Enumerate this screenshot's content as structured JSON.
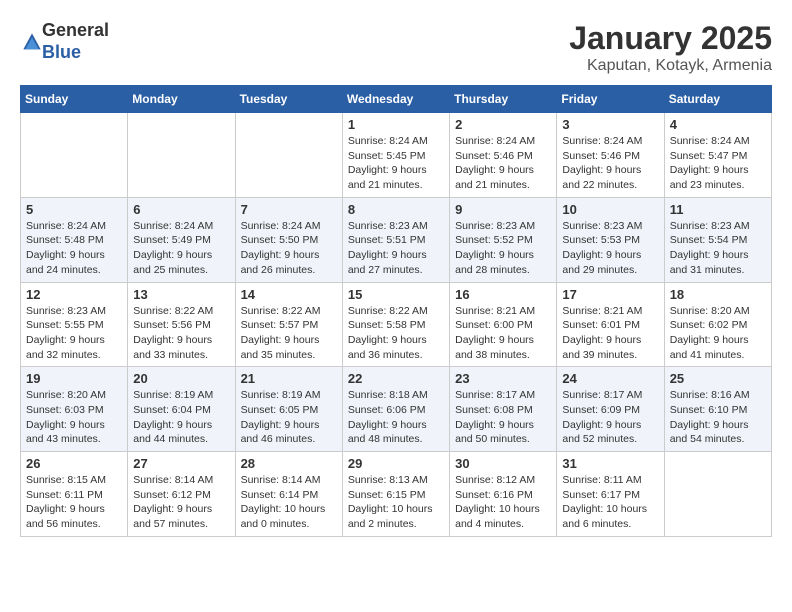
{
  "logo": {
    "general": "General",
    "blue": "Blue"
  },
  "header": {
    "title": "January 2025",
    "subtitle": "Kaputan, Kotayk, Armenia"
  },
  "days_of_week": [
    "Sunday",
    "Monday",
    "Tuesday",
    "Wednesday",
    "Thursday",
    "Friday",
    "Saturday"
  ],
  "weeks": [
    [
      {
        "day": "",
        "sunrise": "",
        "sunset": "",
        "daylight": ""
      },
      {
        "day": "",
        "sunrise": "",
        "sunset": "",
        "daylight": ""
      },
      {
        "day": "",
        "sunrise": "",
        "sunset": "",
        "daylight": ""
      },
      {
        "day": "1",
        "sunrise": "Sunrise: 8:24 AM",
        "sunset": "Sunset: 5:45 PM",
        "daylight": "Daylight: 9 hours and 21 minutes."
      },
      {
        "day": "2",
        "sunrise": "Sunrise: 8:24 AM",
        "sunset": "Sunset: 5:46 PM",
        "daylight": "Daylight: 9 hours and 21 minutes."
      },
      {
        "day": "3",
        "sunrise": "Sunrise: 8:24 AM",
        "sunset": "Sunset: 5:46 PM",
        "daylight": "Daylight: 9 hours and 22 minutes."
      },
      {
        "day": "4",
        "sunrise": "Sunrise: 8:24 AM",
        "sunset": "Sunset: 5:47 PM",
        "daylight": "Daylight: 9 hours and 23 minutes."
      }
    ],
    [
      {
        "day": "5",
        "sunrise": "Sunrise: 8:24 AM",
        "sunset": "Sunset: 5:48 PM",
        "daylight": "Daylight: 9 hours and 24 minutes."
      },
      {
        "day": "6",
        "sunrise": "Sunrise: 8:24 AM",
        "sunset": "Sunset: 5:49 PM",
        "daylight": "Daylight: 9 hours and 25 minutes."
      },
      {
        "day": "7",
        "sunrise": "Sunrise: 8:24 AM",
        "sunset": "Sunset: 5:50 PM",
        "daylight": "Daylight: 9 hours and 26 minutes."
      },
      {
        "day": "8",
        "sunrise": "Sunrise: 8:23 AM",
        "sunset": "Sunset: 5:51 PM",
        "daylight": "Daylight: 9 hours and 27 minutes."
      },
      {
        "day": "9",
        "sunrise": "Sunrise: 8:23 AM",
        "sunset": "Sunset: 5:52 PM",
        "daylight": "Daylight: 9 hours and 28 minutes."
      },
      {
        "day": "10",
        "sunrise": "Sunrise: 8:23 AM",
        "sunset": "Sunset: 5:53 PM",
        "daylight": "Daylight: 9 hours and 29 minutes."
      },
      {
        "day": "11",
        "sunrise": "Sunrise: 8:23 AM",
        "sunset": "Sunset: 5:54 PM",
        "daylight": "Daylight: 9 hours and 31 minutes."
      }
    ],
    [
      {
        "day": "12",
        "sunrise": "Sunrise: 8:23 AM",
        "sunset": "Sunset: 5:55 PM",
        "daylight": "Daylight: 9 hours and 32 minutes."
      },
      {
        "day": "13",
        "sunrise": "Sunrise: 8:22 AM",
        "sunset": "Sunset: 5:56 PM",
        "daylight": "Daylight: 9 hours and 33 minutes."
      },
      {
        "day": "14",
        "sunrise": "Sunrise: 8:22 AM",
        "sunset": "Sunset: 5:57 PM",
        "daylight": "Daylight: 9 hours and 35 minutes."
      },
      {
        "day": "15",
        "sunrise": "Sunrise: 8:22 AM",
        "sunset": "Sunset: 5:58 PM",
        "daylight": "Daylight: 9 hours and 36 minutes."
      },
      {
        "day": "16",
        "sunrise": "Sunrise: 8:21 AM",
        "sunset": "Sunset: 6:00 PM",
        "daylight": "Daylight: 9 hours and 38 minutes."
      },
      {
        "day": "17",
        "sunrise": "Sunrise: 8:21 AM",
        "sunset": "Sunset: 6:01 PM",
        "daylight": "Daylight: 9 hours and 39 minutes."
      },
      {
        "day": "18",
        "sunrise": "Sunrise: 8:20 AM",
        "sunset": "Sunset: 6:02 PM",
        "daylight": "Daylight: 9 hours and 41 minutes."
      }
    ],
    [
      {
        "day": "19",
        "sunrise": "Sunrise: 8:20 AM",
        "sunset": "Sunset: 6:03 PM",
        "daylight": "Daylight: 9 hours and 43 minutes."
      },
      {
        "day": "20",
        "sunrise": "Sunrise: 8:19 AM",
        "sunset": "Sunset: 6:04 PM",
        "daylight": "Daylight: 9 hours and 44 minutes."
      },
      {
        "day": "21",
        "sunrise": "Sunrise: 8:19 AM",
        "sunset": "Sunset: 6:05 PM",
        "daylight": "Daylight: 9 hours and 46 minutes."
      },
      {
        "day": "22",
        "sunrise": "Sunrise: 8:18 AM",
        "sunset": "Sunset: 6:06 PM",
        "daylight": "Daylight: 9 hours and 48 minutes."
      },
      {
        "day": "23",
        "sunrise": "Sunrise: 8:17 AM",
        "sunset": "Sunset: 6:08 PM",
        "daylight": "Daylight: 9 hours and 50 minutes."
      },
      {
        "day": "24",
        "sunrise": "Sunrise: 8:17 AM",
        "sunset": "Sunset: 6:09 PM",
        "daylight": "Daylight: 9 hours and 52 minutes."
      },
      {
        "day": "25",
        "sunrise": "Sunrise: 8:16 AM",
        "sunset": "Sunset: 6:10 PM",
        "daylight": "Daylight: 9 hours and 54 minutes."
      }
    ],
    [
      {
        "day": "26",
        "sunrise": "Sunrise: 8:15 AM",
        "sunset": "Sunset: 6:11 PM",
        "daylight": "Daylight: 9 hours and 56 minutes."
      },
      {
        "day": "27",
        "sunrise": "Sunrise: 8:14 AM",
        "sunset": "Sunset: 6:12 PM",
        "daylight": "Daylight: 9 hours and 57 minutes."
      },
      {
        "day": "28",
        "sunrise": "Sunrise: 8:14 AM",
        "sunset": "Sunset: 6:14 PM",
        "daylight": "Daylight: 10 hours and 0 minutes."
      },
      {
        "day": "29",
        "sunrise": "Sunrise: 8:13 AM",
        "sunset": "Sunset: 6:15 PM",
        "daylight": "Daylight: 10 hours and 2 minutes."
      },
      {
        "day": "30",
        "sunrise": "Sunrise: 8:12 AM",
        "sunset": "Sunset: 6:16 PM",
        "daylight": "Daylight: 10 hours and 4 minutes."
      },
      {
        "day": "31",
        "sunrise": "Sunrise: 8:11 AM",
        "sunset": "Sunset: 6:17 PM",
        "daylight": "Daylight: 10 hours and 6 minutes."
      },
      {
        "day": "",
        "sunrise": "",
        "sunset": "",
        "daylight": ""
      }
    ]
  ]
}
